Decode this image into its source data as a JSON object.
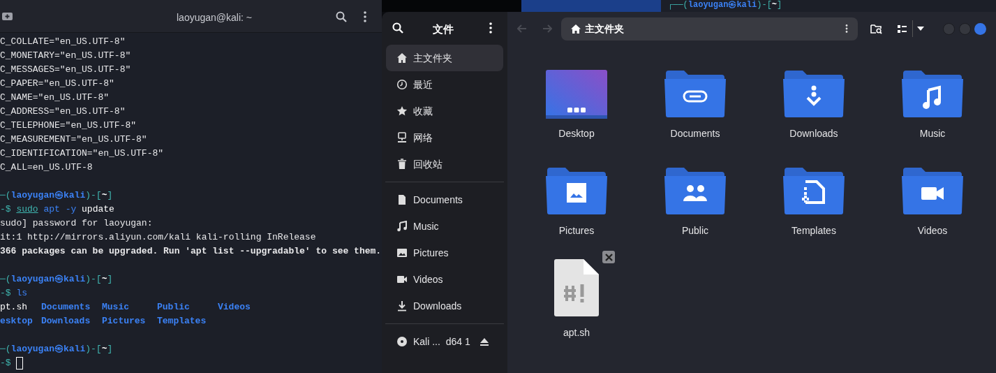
{
  "terminal": {
    "title": "laoyugan@kali: ~",
    "lines": [
      {
        "kind": "output",
        "text": "C_COLLATE=\"en_US.UTF-8\"",
        "bold": false
      },
      {
        "kind": "output",
        "text": "C_MONETARY=\"en_US.UTF-8\"",
        "bold": false
      },
      {
        "kind": "output",
        "text": "C_MESSAGES=\"en_US.UTF-8\"",
        "bold": false
      },
      {
        "kind": "output",
        "text": "C_PAPER=\"en_US.UTF-8\"",
        "bold": false
      },
      {
        "kind": "output",
        "text": "C_NAME=\"en_US.UTF-8\"",
        "bold": false
      },
      {
        "kind": "output",
        "text": "C_ADDRESS=\"en_US.UTF-8\"",
        "bold": false
      },
      {
        "kind": "output",
        "text": "C_TELEPHONE=\"en_US.UTF-8\"",
        "bold": false
      },
      {
        "kind": "output",
        "text": "C_MEASUREMENT=\"en_US.UTF-8\"",
        "bold": false
      },
      {
        "kind": "output",
        "text": "C_IDENTIFICATION=\"en_US.UTF-8\"",
        "bold": false
      },
      {
        "kind": "output",
        "text": "C_ALL=en_US.UTF-8",
        "bold": false
      },
      {
        "kind": "blank"
      },
      {
        "kind": "prompt",
        "segments": [
          {
            "text": "─(",
            "kind": "frame"
          },
          {
            "text": "laoyugan㉿kali",
            "kind": "user"
          },
          {
            "text": ")-[",
            "kind": "frame"
          },
          {
            "text": "~",
            "kind": "dir"
          },
          {
            "text": "]",
            "kind": "frame"
          }
        ]
      },
      {
        "kind": "command",
        "cursor": false,
        "segments": [
          {
            "text": "-$ ",
            "kind": "frame"
          },
          {
            "text": "sudo",
            "kind": "sudo"
          },
          {
            "text": " apt -y",
            "kind": "cmd"
          },
          {
            "text": " update",
            "kind": "arg"
          }
        ]
      },
      {
        "kind": "output",
        "text": "sudo] password for laoyugan:",
        "bold": false
      },
      {
        "kind": "output",
        "text": "it:1 http://mirrors.aliyun.com/kali kali-rolling InRelease",
        "bold": false
      },
      {
        "kind": "output",
        "text": "366 packages can be upgraded. Run 'apt list --upgradable' to see them.",
        "bold": true
      },
      {
        "kind": "blank"
      },
      {
        "kind": "prompt",
        "segments": [
          {
            "text": "─(",
            "kind": "frame"
          },
          {
            "text": "laoyugan㉿kali",
            "kind": "user"
          },
          {
            "text": ")-[",
            "kind": "frame"
          },
          {
            "text": "~",
            "kind": "dir"
          },
          {
            "text": "]",
            "kind": "frame"
          }
        ]
      },
      {
        "kind": "command",
        "cursor": false,
        "segments": [
          {
            "text": "-$ ",
            "kind": "frame"
          },
          {
            "text": "ls",
            "kind": "cmd"
          }
        ]
      },
      {
        "kind": "ls",
        "rows": [
          [
            {
              "name": "pt.sh",
              "kind": "file"
            },
            {
              "name": "Documents",
              "kind": "dir"
            },
            {
              "name": "Music",
              "kind": "dir"
            },
            {
              "name": "Public",
              "kind": "dir"
            },
            {
              "name": "Videos",
              "kind": "dir"
            }
          ],
          [
            {
              "name": "esktop",
              "kind": "dir"
            },
            {
              "name": "Downloads",
              "kind": "dir"
            },
            {
              "name": "Pictures",
              "kind": "dir"
            },
            {
              "name": "Templates",
              "kind": "dir"
            }
          ]
        ]
      },
      {
        "kind": "blank"
      },
      {
        "kind": "prompt",
        "segments": [
          {
            "text": "─(",
            "kind": "frame"
          },
          {
            "text": "laoyugan㉿kali",
            "kind": "user"
          },
          {
            "text": ")-[",
            "kind": "frame"
          },
          {
            "text": "~",
            "kind": "dir"
          },
          {
            "text": "]",
            "kind": "frame"
          }
        ]
      },
      {
        "kind": "command",
        "cursor": true,
        "segments": [
          {
            "text": "-$ ",
            "kind": "frame"
          }
        ]
      }
    ]
  },
  "background_terminal": {
    "segments": [
      {
        "text": "┌──(",
        "kind": "frame"
      },
      {
        "text": "laoyugan㉿kali",
        "kind": "user"
      },
      {
        "text": ")-[",
        "kind": "frame"
      },
      {
        "text": "~",
        "kind": "dir"
      },
      {
        "text": "]",
        "kind": "frame"
      }
    ]
  },
  "files": {
    "title": "文件",
    "sidebar": {
      "places": [
        {
          "label": "主文件夹",
          "selected": true
        },
        {
          "label": "最近",
          "selected": false
        },
        {
          "label": "收藏",
          "selected": false
        },
        {
          "label": "网络",
          "selected": false
        },
        {
          "label": "回收站",
          "selected": false
        }
      ],
      "bookmarks": [
        {
          "label": "Documents",
          "selected": false
        },
        {
          "label": "Music",
          "selected": false
        },
        {
          "label": "Pictures",
          "selected": false
        },
        {
          "label": "Videos",
          "selected": false
        },
        {
          "label": "Downloads",
          "selected": false
        }
      ],
      "devices": [
        {
          "label": "Kali ...  d64 1"
        }
      ]
    },
    "path": "主文件夹",
    "items": [
      {
        "name": "Desktop",
        "kind": "desktop",
        "close_badge": false
      },
      {
        "name": "Documents",
        "kind": "documents",
        "close_badge": false
      },
      {
        "name": "Downloads",
        "kind": "downloads",
        "close_badge": false
      },
      {
        "name": "Music",
        "kind": "music",
        "close_badge": false
      },
      {
        "name": "Pictures",
        "kind": "pictures",
        "close_badge": false
      },
      {
        "name": "Public",
        "kind": "public",
        "close_badge": false
      },
      {
        "name": "Templates",
        "kind": "templates",
        "close_badge": false
      },
      {
        "name": "Videos",
        "kind": "videos",
        "close_badge": false
      },
      {
        "name": "apt.sh",
        "kind": "script",
        "close_badge": true
      }
    ]
  }
}
